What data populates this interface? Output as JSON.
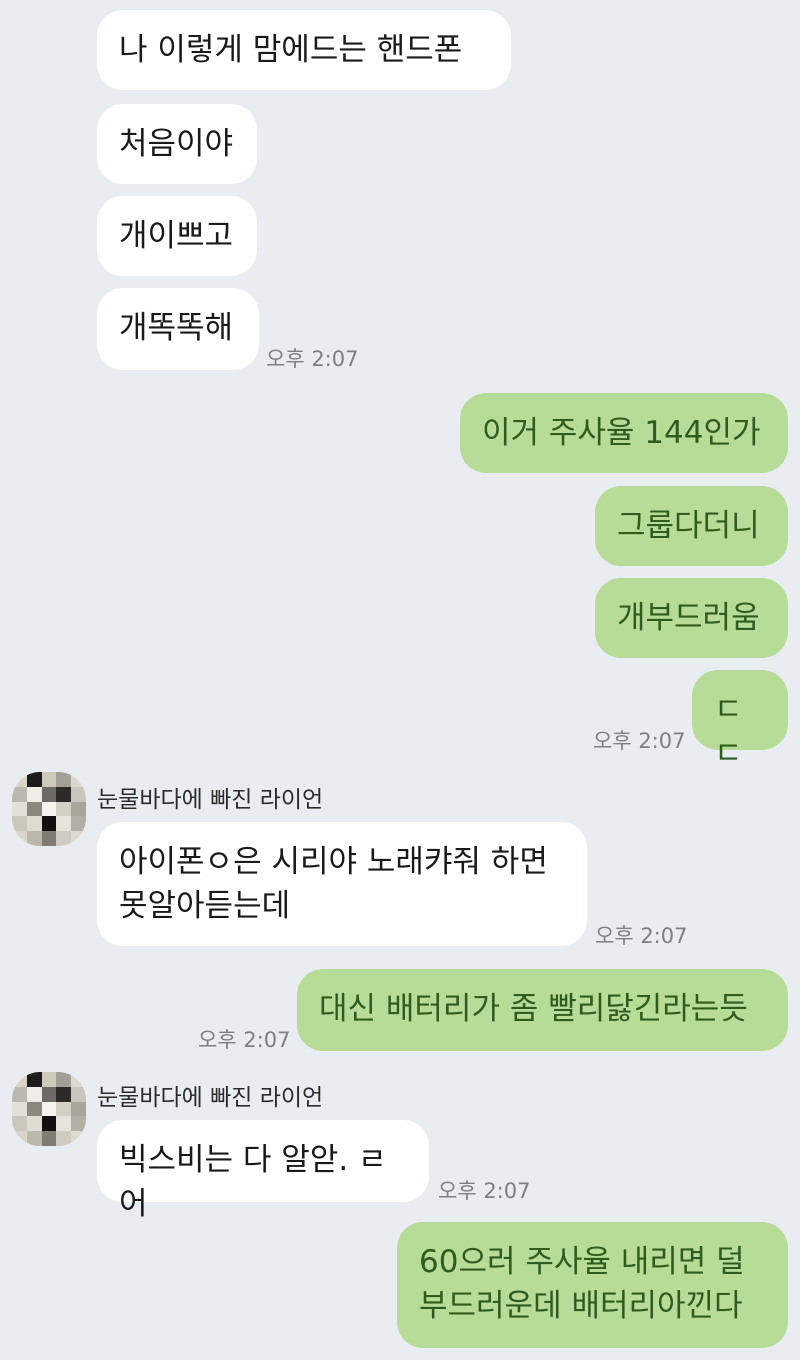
{
  "chat": {
    "sender_name": "눈물바다에 빠진 라이언",
    "messages": [
      {
        "text": "나 이렇게 맘에드는 핸드폰"
      },
      {
        "text": "처음이야"
      },
      {
        "text": "개이쁘고"
      },
      {
        "text": "개똑똑해",
        "time": "오후 2:07"
      },
      {
        "text": "이거 주사율 144인가"
      },
      {
        "text": "그룹다더니"
      },
      {
        "text": "개부드러움"
      },
      {
        "text": "ㄷㄷ",
        "time": "오후 2:07"
      },
      {
        "text": "아이폰ㅇ은 시리야 노래캬줘 하면\n못알아듣는데",
        "time": "오후 2:07"
      },
      {
        "text": "대신 배터리가 좀 빨리닳긴라는듯",
        "time": "오후 2:07"
      },
      {
        "text": "빅스비는 다 알앋. ㄹ어",
        "time": "오후 2:07"
      },
      {
        "text": "60으러 주사율 내리면 덜\n부드러운데 배터리아낀다"
      }
    ]
  },
  "colors": {
    "background": "#e9edf2",
    "incoming_bubble": "#ffffff",
    "outgoing_bubble": "#b6dc98",
    "outgoing_text": "#2f5b1d"
  },
  "icons": {
    "avatar": "pixelated-profile-photo"
  }
}
